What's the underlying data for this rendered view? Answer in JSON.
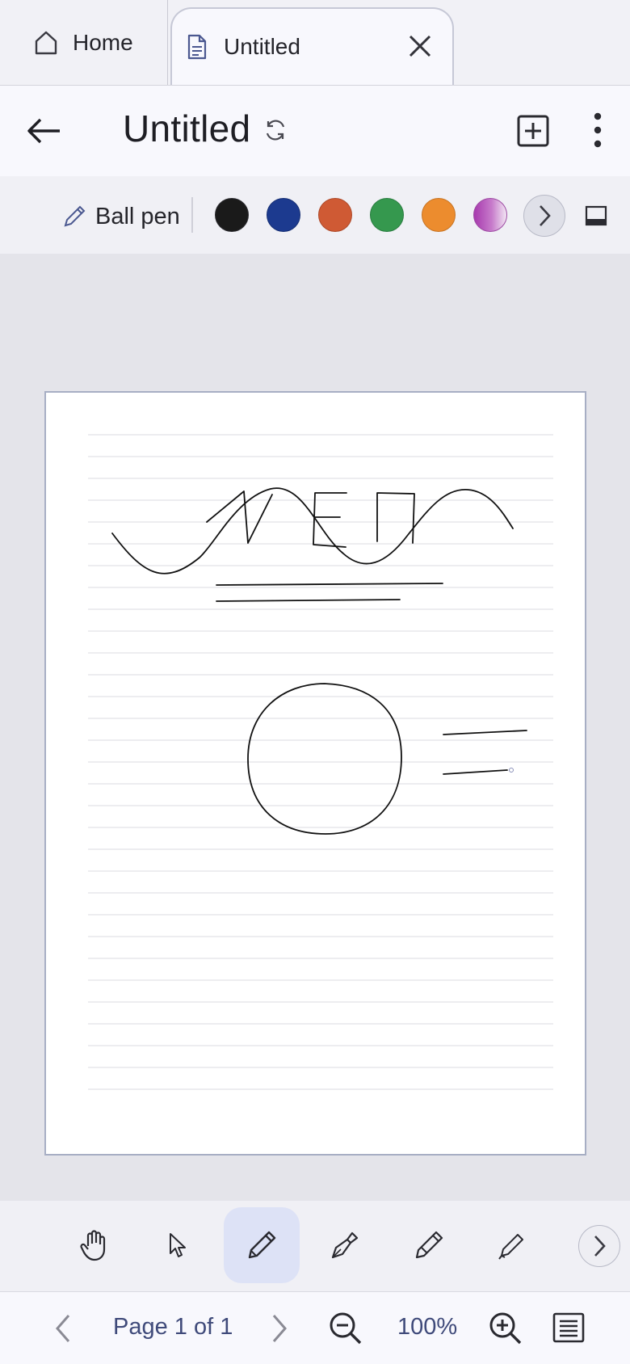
{
  "tabs": {
    "home_label": "Home",
    "doc_label": "Untitled"
  },
  "appbar": {
    "title": "Untitled"
  },
  "pen": {
    "type_label": "Ball pen",
    "colors": [
      "#1a1a1a",
      "#1c3a8f",
      "#cf5a34",
      "#35984e",
      "#ec8c2e",
      "#b352b8"
    ]
  },
  "status": {
    "page_indicator": "Page 1 of 1",
    "zoom": "100%"
  }
}
